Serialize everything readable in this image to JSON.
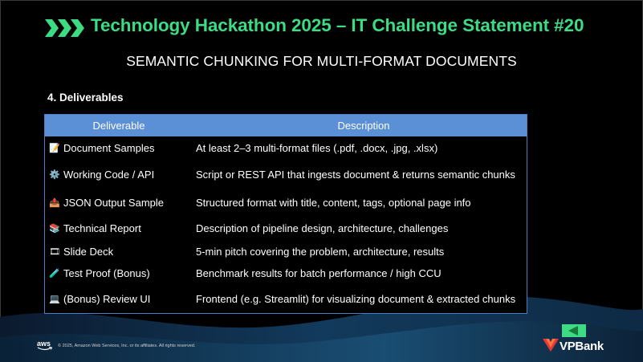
{
  "header": {
    "title": "Technology Hackathon 2025 – IT Challenge Statement #20",
    "subtitle": "SEMANTIC CHUNKING FOR MULTI-FORMAT DOCUMENTS",
    "accent_color": "#3ddc84"
  },
  "section": {
    "heading": "4. Deliverables"
  },
  "table": {
    "header_color": "#5b8fd6",
    "columns": [
      "Deliverable",
      "Description"
    ],
    "rows": [
      {
        "icon": "memo-icon",
        "glyph": "📝",
        "deliverable": "Document Samples",
        "description": "At least 2–3 multi-format files (.pdf, .docx, .jpg, .xlsx)"
      },
      {
        "icon": "gear-icon",
        "glyph": "⚙️",
        "deliverable": "Working Code / API",
        "description": "Script or REST API that ingests document & returns semantic chunks"
      },
      {
        "icon": "upload-icon",
        "glyph": "📤",
        "deliverable": "JSON Output Sample",
        "description": "Structured format with title, content, tags, optional page info"
      },
      {
        "icon": "report-icon",
        "glyph": "📚",
        "deliverable": "Technical Report",
        "description": "Description of pipeline design, architecture, challenges"
      },
      {
        "icon": "slides-icon",
        "glyph": "🎞",
        "deliverable": "Slide Deck",
        "description": "5-min pitch covering the problem, architecture, results"
      },
      {
        "icon": "test-tube-icon",
        "glyph": "🧪",
        "deliverable": "Test Proof (Bonus)",
        "description": "Benchmark results for batch performance / high CCU"
      },
      {
        "icon": "laptop-icon",
        "glyph": "💻",
        "deliverable": "(Bonus) Review UI",
        "description": "Frontend (e.g. Streamlit) for visualizing document & extracted chunks"
      }
    ]
  },
  "footer": {
    "aws_logo": "aws",
    "copyright": "© 2025, Amazon Web Services, Inc. or its affiliates. All rights reserved.",
    "brand": "VPBank"
  }
}
